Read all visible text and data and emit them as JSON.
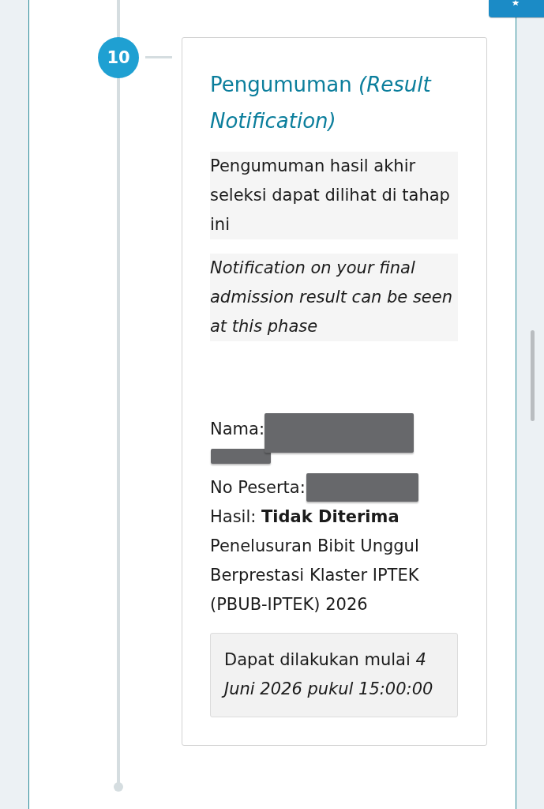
{
  "step": {
    "number": "10",
    "title": "Pengumuman *(Result Notification)*",
    "descriptions": [
      {
        "kind": "plain",
        "text": "Pengumuman hasil akhir seleksi dapat dilihat di tahap ini"
      },
      {
        "kind": "translation",
        "text": "Notification on your final admission result can be seen at this phase"
      }
    ],
    "participant": {
      "name_label": "Nama:",
      "name_redacted": true,
      "number_label": "No Peserta:",
      "number_redacted": true,
      "result": "Hasil: **Tidak Diterima**",
      "program": "Penelusuran Bibit Unggul Berprestasi Klaster IPTEK (PBUB-IPTEK) 2026"
    },
    "schedule": "Dapat dilakukan mulai *4 Juni 2026 pukul 15:00:00*"
  }
}
